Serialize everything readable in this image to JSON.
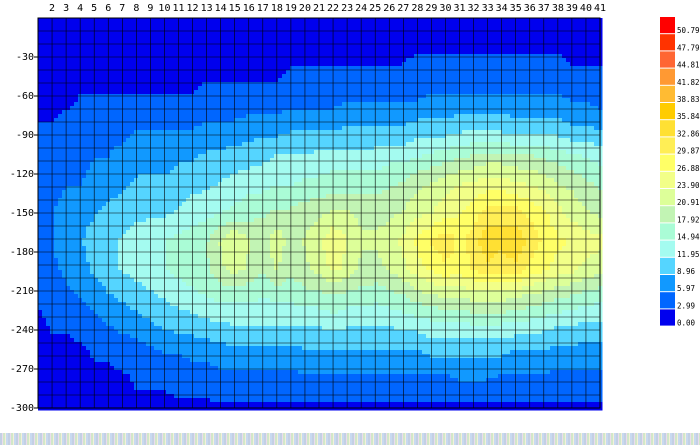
{
  "chart_data": {
    "type": "heatmap",
    "subtype": "filled-contour",
    "x_ticks": [
      2,
      3,
      4,
      5,
      6,
      7,
      8,
      9,
      10,
      11,
      12,
      13,
      14,
      15,
      16,
      17,
      18,
      19,
      20,
      21,
      22,
      23,
      24,
      25,
      26,
      27,
      28,
      29,
      30,
      31,
      32,
      33,
      34,
      35,
      36,
      37,
      38,
      39,
      40,
      41
    ],
    "y_ticks": [
      -30,
      -60,
      -90,
      -120,
      -150,
      -180,
      -210,
      -240,
      -270,
      -300
    ],
    "xlim": [
      1,
      41
    ],
    "ylim": [
      -300,
      0
    ],
    "grid": true,
    "legend": {
      "placement": "right",
      "levels": [
        "50.79",
        "47.79",
        "44.81",
        "41.82",
        "38.83",
        "35.84",
        "32.86",
        "29.87",
        "26.88",
        "23.90",
        "20.91",
        "17.92",
        "14.94",
        "11.95",
        "8.96",
        "5.97",
        "2.99",
        "0.00"
      ],
      "colors": [
        "#ff0000",
        "#ff3300",
        "#ff6633",
        "#ff9933",
        "#ffbb33",
        "#ffcc00",
        "#ffe033",
        "#ffee55",
        "#ffff66",
        "#f2ff88",
        "#ddff99",
        "#c2f4b4",
        "#aafcd6",
        "#a4fbf0",
        "#55d5ff",
        "#1199ff",
        "#0066ff",
        "#0000ee"
      ]
    },
    "values_grid_note": "",
    "z_grid": [
      [
        1,
        1,
        1,
        1,
        1,
        1,
        1,
        1,
        1,
        1,
        1,
        1,
        1,
        1,
        1,
        1,
        1,
        1,
        1,
        1,
        1,
        1,
        1,
        1,
        1,
        1,
        1,
        1,
        1,
        1,
        1,
        1,
        1,
        1,
        1,
        1,
        1,
        1,
        1,
        1,
        1
      ],
      [
        1,
        1,
        1,
        1,
        1,
        1,
        1,
        1,
        1,
        1,
        1,
        1,
        1,
        1,
        1,
        1,
        1,
        1,
        1,
        1,
        1,
        1,
        1,
        1,
        1,
        1,
        1,
        1,
        1,
        1,
        1,
        1,
        1,
        1,
        1,
        1,
        1,
        1,
        1,
        1,
        1
      ],
      [
        1,
        1,
        1,
        1,
        1,
        1,
        1,
        1,
        1,
        1,
        1,
        1,
        1,
        1,
        1,
        1,
        1,
        1,
        2,
        2,
        2,
        2,
        2,
        2,
        2,
        2,
        2,
        3,
        3,
        3,
        3,
        3,
        3,
        3,
        3,
        3,
        3,
        3,
        2,
        2,
        2
      ],
      [
        1,
        1,
        1,
        2,
        2,
        2,
        2,
        2,
        2,
        2,
        2,
        2,
        3,
        3,
        3,
        3,
        3,
        3,
        4,
        4,
        4,
        4,
        5,
        5,
        5,
        5,
        5,
        5,
        6,
        6,
        6,
        6,
        6,
        6,
        6,
        6,
        6,
        6,
        5,
        5,
        4
      ],
      [
        2,
        2,
        3,
        3,
        4,
        4,
        4,
        5,
        5,
        5,
        5,
        5,
        6,
        6,
        6,
        7,
        7,
        7,
        8,
        8,
        8,
        8,
        9,
        9,
        9,
        9,
        9,
        10,
        10,
        10,
        11,
        11,
        11,
        11,
        10,
        10,
        10,
        10,
        9,
        9,
        8
      ],
      [
        3,
        3,
        4,
        4,
        5,
        5,
        6,
        7,
        7,
        7,
        8,
        8,
        9,
        9,
        10,
        10,
        11,
        12,
        12,
        12,
        13,
        13,
        13,
        13,
        13,
        14,
        14,
        15,
        16,
        17,
        18,
        19,
        20,
        20,
        19,
        19,
        18,
        17,
        16,
        15,
        14
      ],
      [
        4,
        4,
        5,
        5,
        6,
        7,
        8,
        9,
        9,
        9,
        10,
        11,
        11,
        12,
        13,
        14,
        14,
        15,
        15,
        16,
        16,
        17,
        17,
        17,
        17,
        18,
        19,
        21,
        22,
        24,
        25,
        26,
        27,
        27,
        26,
        25,
        24,
        22,
        21,
        19,
        18
      ],
      [
        4,
        5,
        6,
        7,
        8,
        9,
        10,
        11,
        11,
        11,
        12,
        13,
        14,
        15,
        16,
        17,
        18,
        19,
        19,
        20,
        21,
        22,
        22,
        21,
        21,
        21,
        22,
        24,
        25,
        27,
        28,
        30,
        33,
        34,
        33,
        31,
        29,
        26,
        24,
        22,
        21
      ],
      [
        4,
        5,
        7,
        8,
        10,
        11,
        12,
        13,
        14,
        15,
        16,
        17,
        18,
        22,
        25,
        22,
        20,
        24,
        20,
        22,
        24,
        28,
        25,
        22,
        22,
        23,
        26,
        29,
        32,
        34,
        31,
        33,
        38,
        36,
        38,
        34,
        31,
        29,
        28,
        27,
        26
      ],
      [
        3,
        4,
        6,
        7,
        9,
        11,
        12,
        13,
        14,
        15,
        16,
        17,
        18,
        21,
        23,
        21,
        19,
        22,
        19,
        21,
        23,
        26,
        24,
        21,
        21,
        22,
        24,
        27,
        29,
        31,
        30,
        32,
        34,
        33,
        34,
        31,
        29,
        27,
        26,
        24,
        23
      ],
      [
        2,
        3,
        4,
        5,
        6,
        8,
        9,
        10,
        11,
        12,
        13,
        14,
        15,
        16,
        16,
        16,
        15,
        16,
        16,
        17,
        17,
        18,
        17,
        17,
        16,
        17,
        18,
        20,
        21,
        22,
        22,
        23,
        23,
        23,
        22,
        21,
        20,
        19,
        18,
        17,
        16
      ],
      [
        1,
        2,
        2,
        3,
        4,
        5,
        6,
        7,
        8,
        9,
        10,
        10,
        11,
        11,
        12,
        12,
        12,
        12,
        12,
        12,
        12,
        13,
        12,
        12,
        12,
        12,
        13,
        13,
        14,
        14,
        14,
        15,
        15,
        15,
        14,
        14,
        13,
        12,
        12,
        11,
        11
      ],
      [
        1,
        1,
        1,
        1,
        2,
        2,
        3,
        3,
        4,
        5,
        5,
        6,
        6,
        7,
        7,
        7,
        7,
        7,
        7,
        8,
        8,
        8,
        8,
        8,
        8,
        8,
        8,
        8,
        9,
        9,
        9,
        9,
        9,
        9,
        8,
        8,
        8,
        7,
        7,
        7,
        7
      ],
      [
        1,
        1,
        1,
        1,
        1,
        1,
        1,
        2,
        2,
        2,
        3,
        3,
        3,
        4,
        4,
        4,
        4,
        4,
        4,
        4,
        4,
        4,
        4,
        4,
        4,
        4,
        4,
        4,
        4,
        4,
        5,
        5,
        5,
        4,
        4,
        4,
        4,
        4,
        4,
        4,
        4
      ],
      [
        1,
        1,
        1,
        1,
        1,
        1,
        1,
        1,
        1,
        1,
        1,
        1,
        1,
        1,
        1,
        1,
        1,
        1,
        1,
        1,
        1,
        1,
        1,
        1,
        1,
        1,
        1,
        1,
        1,
        1,
        1,
        1,
        1,
        1,
        1,
        1,
        1,
        1,
        1,
        1,
        1
      ]
    ]
  }
}
